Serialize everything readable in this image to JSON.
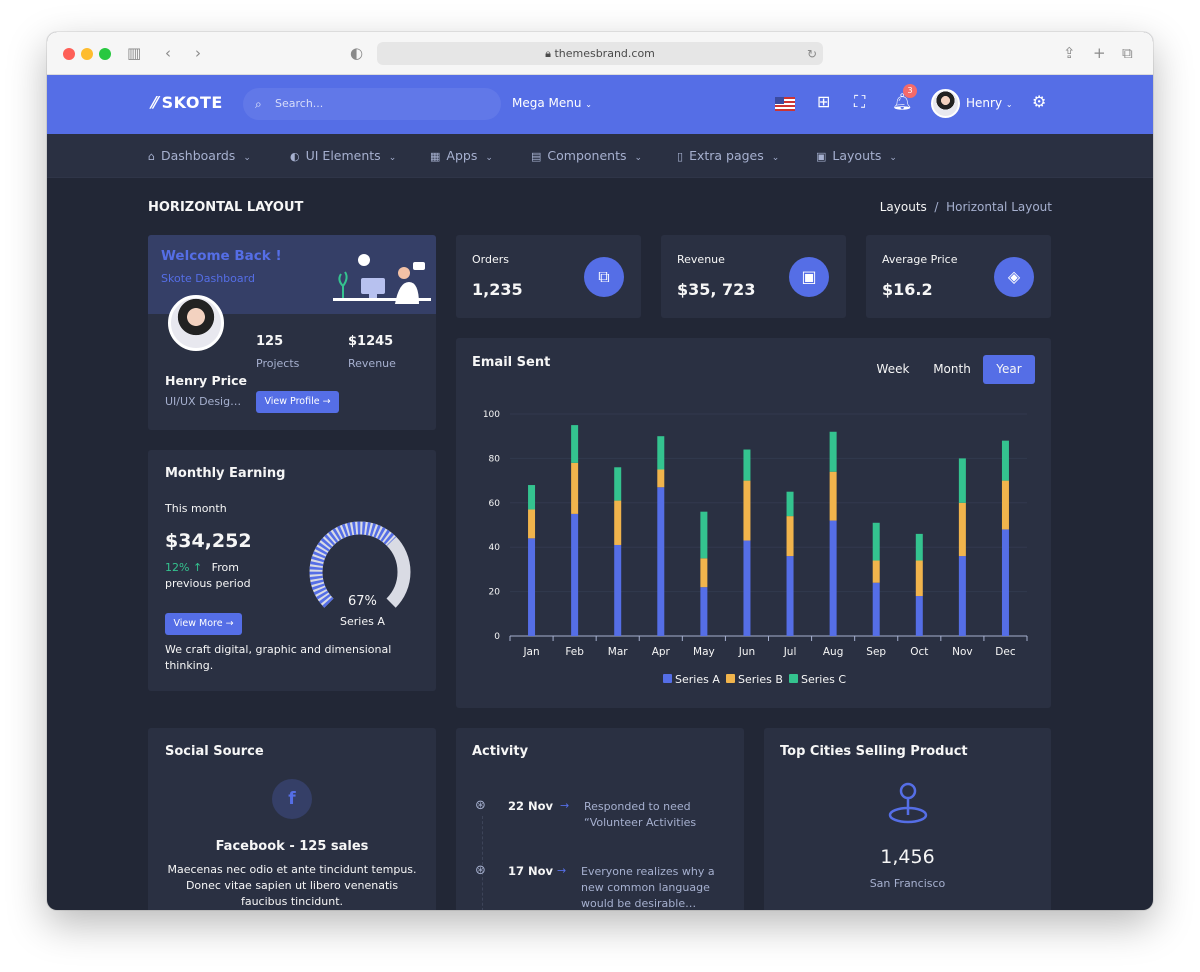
{
  "browser": {
    "url": "themesbrand.com"
  },
  "topbar": {
    "brand": "SKOTE",
    "search_placeholder": "Search...",
    "mega_menu": "Mega Menu",
    "notification_count": "3",
    "user_name": "Henry"
  },
  "nav": [
    {
      "icon": "home-icon",
      "glyph": "⌂",
      "label": "Dashboards"
    },
    {
      "icon": "tone-icon",
      "glyph": "◐",
      "label": "UI Elements"
    },
    {
      "icon": "apps-icon",
      "glyph": "▦",
      "label": "Apps"
    },
    {
      "icon": "components-icon",
      "glyph": "▤",
      "label": "Components"
    },
    {
      "icon": "file-icon",
      "glyph": "▯",
      "label": "Extra pages"
    },
    {
      "icon": "layout-icon",
      "glyph": "▣",
      "label": "Layouts"
    }
  ],
  "page": {
    "title": "HORIZONTAL LAYOUT",
    "breadcrumb": [
      "Layouts",
      "/",
      "Horizontal Layout"
    ]
  },
  "welcome": {
    "title": "Welcome Back !",
    "subtitle": "Skote Dashboard",
    "name": "Henry Price",
    "role": "UI/UX Desig…",
    "projects_value": "125",
    "projects_label": "Projects",
    "revenue_value": "$1245",
    "revenue_label": "Revenue",
    "button": "View Profile →"
  },
  "stats": [
    {
      "label": "Orders",
      "value": "1,235",
      "icon": "copy-icon",
      "glyph": "⧉"
    },
    {
      "label": "Revenue",
      "value": "$35, 723",
      "icon": "archive-icon",
      "glyph": "▣"
    },
    {
      "label": "Average Price",
      "value": "$16.2",
      "icon": "tag-icon",
      "glyph": "◈"
    }
  ],
  "earning": {
    "title": "Monthly Earning",
    "period": "This month",
    "amount": "$34,252",
    "change": "12% ↑",
    "change_text": "From",
    "change_text2": "previous period",
    "button": "View More →",
    "gauge_value": "67%",
    "gauge_label": "Series A",
    "gauge_fraction": 0.67,
    "footer": "We craft digital, graphic and dimensional",
    "footer2": "thinking."
  },
  "email": {
    "title": "Email Sent",
    "tabs": [
      "Week",
      "Month",
      "Year"
    ],
    "active_tab": "Year"
  },
  "chart_data": {
    "type": "bar",
    "stacked": true,
    "categories": [
      "Jan",
      "Feb",
      "Mar",
      "Apr",
      "May",
      "Jun",
      "Jul",
      "Aug",
      "Sep",
      "Oct",
      "Nov",
      "Dec"
    ],
    "series": [
      {
        "name": "Series A",
        "color": "#556ee6",
        "values": [
          44,
          55,
          41,
          67,
          22,
          43,
          36,
          52,
          24,
          18,
          36,
          48
        ]
      },
      {
        "name": "Series B",
        "color": "#f1b44c",
        "values": [
          13,
          23,
          20,
          8,
          13,
          27,
          18,
          22,
          10,
          16,
          24,
          22
        ]
      },
      {
        "name": "Series C",
        "color": "#34c38f",
        "values": [
          11,
          17,
          15,
          15,
          21,
          14,
          11,
          18,
          17,
          12,
          20,
          18
        ]
      }
    ],
    "ylim": [
      0,
      100
    ],
    "yticks": [
      "0",
      "20",
      "40",
      "60",
      "80",
      "100"
    ],
    "legend": "bottom",
    "grid": true
  },
  "social": {
    "title": "Social Source",
    "headline": "Facebook - 125 sales",
    "lines": [
      "Maecenas nec odio et ante tincidunt tempus.",
      "Donec vitae sapien ut libero venenatis",
      "faucibus tincidunt."
    ]
  },
  "activity": {
    "title": "Activity",
    "items": [
      {
        "date": "22 Nov",
        "l1": "Responded to need",
        "l2": "“Volunteer Activities"
      },
      {
        "date": "17 Nov",
        "l1": "Everyone realizes why a",
        "l2": "new common language",
        "l3": "would be desirable…"
      }
    ]
  },
  "cities": {
    "title": "Top Cities Selling Product",
    "value": "1,456",
    "city": "San Francisco"
  }
}
